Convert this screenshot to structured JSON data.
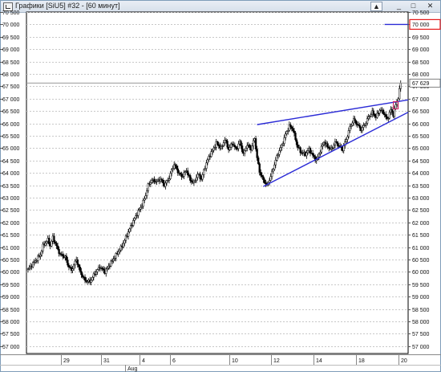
{
  "window": {
    "title": "Графики [SiU5] #32 - [60 минут]",
    "btn_scroll": "▲",
    "btn_minimize": "_",
    "btn_maximize": "□",
    "btn_close": "✕",
    "icon": "chart-window-icon"
  },
  "chart_data": {
    "type": "candlestick",
    "instrument": "SiU5",
    "timeframe": "60 минут",
    "y_ticks": [
      "57 000",
      "57 500",
      "58 000",
      "58 500",
      "59 000",
      "59 500",
      "60 000",
      "60 500",
      "61 000",
      "61 500",
      "62 000",
      "62 500",
      "63 000",
      "63 500",
      "64 000",
      "64 500",
      "65 000",
      "65 500",
      "66 000",
      "66 500",
      "67 000",
      "67 500",
      "68 000",
      "68 500",
      "69 000",
      "69 500",
      "70 000",
      "70 500"
    ],
    "ylim": [
      56700,
      70500
    ],
    "x_ticks": [
      "29",
      "31",
      "4",
      "6",
      "10",
      "12",
      "14",
      "18",
      "20"
    ],
    "x_month_label": "Aug",
    "grid": true,
    "last_price_label": "67 629",
    "last_price": 67629,
    "target_level_label": "70 000",
    "target_level": 70000,
    "price_path": [
      [
        0,
        60100
      ],
      [
        6,
        60450
      ],
      [
        10,
        60700
      ],
      [
        12,
        61050
      ],
      [
        16,
        61300
      ],
      [
        18,
        61050
      ],
      [
        20,
        61400
      ],
      [
        24,
        60900
      ],
      [
        26,
        60700
      ],
      [
        30,
        60600
      ],
      [
        32,
        60300
      ],
      [
        35,
        60050
      ],
      [
        39,
        60500
      ],
      [
        42,
        60000
      ],
      [
        46,
        59650
      ],
      [
        50,
        59600
      ],
      [
        54,
        59950
      ],
      [
        58,
        60200
      ],
      [
        62,
        60000
      ],
      [
        64,
        60150
      ],
      [
        68,
        60450
      ],
      [
        72,
        60750
      ],
      [
        76,
        61050
      ],
      [
        80,
        61500
      ],
      [
        84,
        61950
      ],
      [
        88,
        62350
      ],
      [
        92,
        62700
      ],
      [
        95,
        63100
      ],
      [
        97,
        63500
      ],
      [
        100,
        63700
      ],
      [
        104,
        63650
      ],
      [
        107,
        63750
      ],
      [
        110,
        63500
      ],
      [
        114,
        63800
      ],
      [
        116,
        64100
      ],
      [
        118,
        64350
      ],
      [
        121,
        64050
      ],
      [
        124,
        63850
      ],
      [
        128,
        64100
      ],
      [
        131,
        63700
      ],
      [
        134,
        63600
      ],
      [
        137,
        63950
      ],
      [
        140,
        63750
      ],
      [
        143,
        64250
      ],
      [
        146,
        64650
      ],
      [
        149,
        64900
      ],
      [
        152,
        65200
      ],
      [
        156,
        65000
      ],
      [
        159,
        65350
      ],
      [
        162,
        64950
      ],
      [
        165,
        65200
      ],
      [
        168,
        64950
      ],
      [
        171,
        65250
      ],
      [
        174,
        64750
      ],
      [
        177,
        65150
      ],
      [
        180,
        64950
      ],
      [
        183,
        65400
      ],
      [
        185,
        64600
      ],
      [
        187,
        64050
      ],
      [
        190,
        63700
      ],
      [
        193,
        63500
      ],
      [
        196,
        63850
      ],
      [
        199,
        64350
      ],
      [
        202,
        64800
      ],
      [
        205,
        65100
      ],
      [
        208,
        65550
      ],
      [
        211,
        65900
      ],
      [
        214,
        65750
      ],
      [
        217,
        65150
      ],
      [
        220,
        64850
      ],
      [
        224,
        64750
      ],
      [
        227,
        64950
      ],
      [
        230,
        64700
      ],
      [
        233,
        64500
      ],
      [
        236,
        64900
      ],
      [
        239,
        65250
      ],
      [
        242,
        65050
      ],
      [
        245,
        64950
      ],
      [
        248,
        65250
      ],
      [
        251,
        65100
      ],
      [
        254,
        64950
      ],
      [
        257,
        65350
      ],
      [
        260,
        65850
      ],
      [
        263,
        66150
      ],
      [
        266,
        65950
      ],
      [
        269,
        65750
      ],
      [
        272,
        65950
      ],
      [
        275,
        66250
      ],
      [
        278,
        66450
      ],
      [
        281,
        66250
      ],
      [
        284,
        66550
      ],
      [
        287,
        66450
      ],
      [
        290,
        66150
      ],
      [
        293,
        66550
      ],
      [
        295,
        66350
      ],
      [
        297,
        66750
      ],
      [
        299,
        67050
      ],
      [
        301,
        67629
      ]
    ],
    "trendlines": [
      {
        "name": "upper",
        "from": [
          185,
          65950
        ],
        "to": [
          307,
          66950
        ]
      },
      {
        "name": "lower",
        "from": [
          190,
          63450
        ],
        "to": [
          307,
          66450
        ]
      },
      {
        "name": "target",
        "from": [
          288,
          70000
        ],
        "to": [
          307,
          70000
        ]
      }
    ],
    "highlight": {
      "x": 297,
      "y": 66750
    },
    "colors": {
      "candles": "#000000",
      "trendline": "#2b2bd6",
      "highlight": "#cc2a6a",
      "target_box": "#e41b1b",
      "grid": "#c8c8c8"
    }
  }
}
